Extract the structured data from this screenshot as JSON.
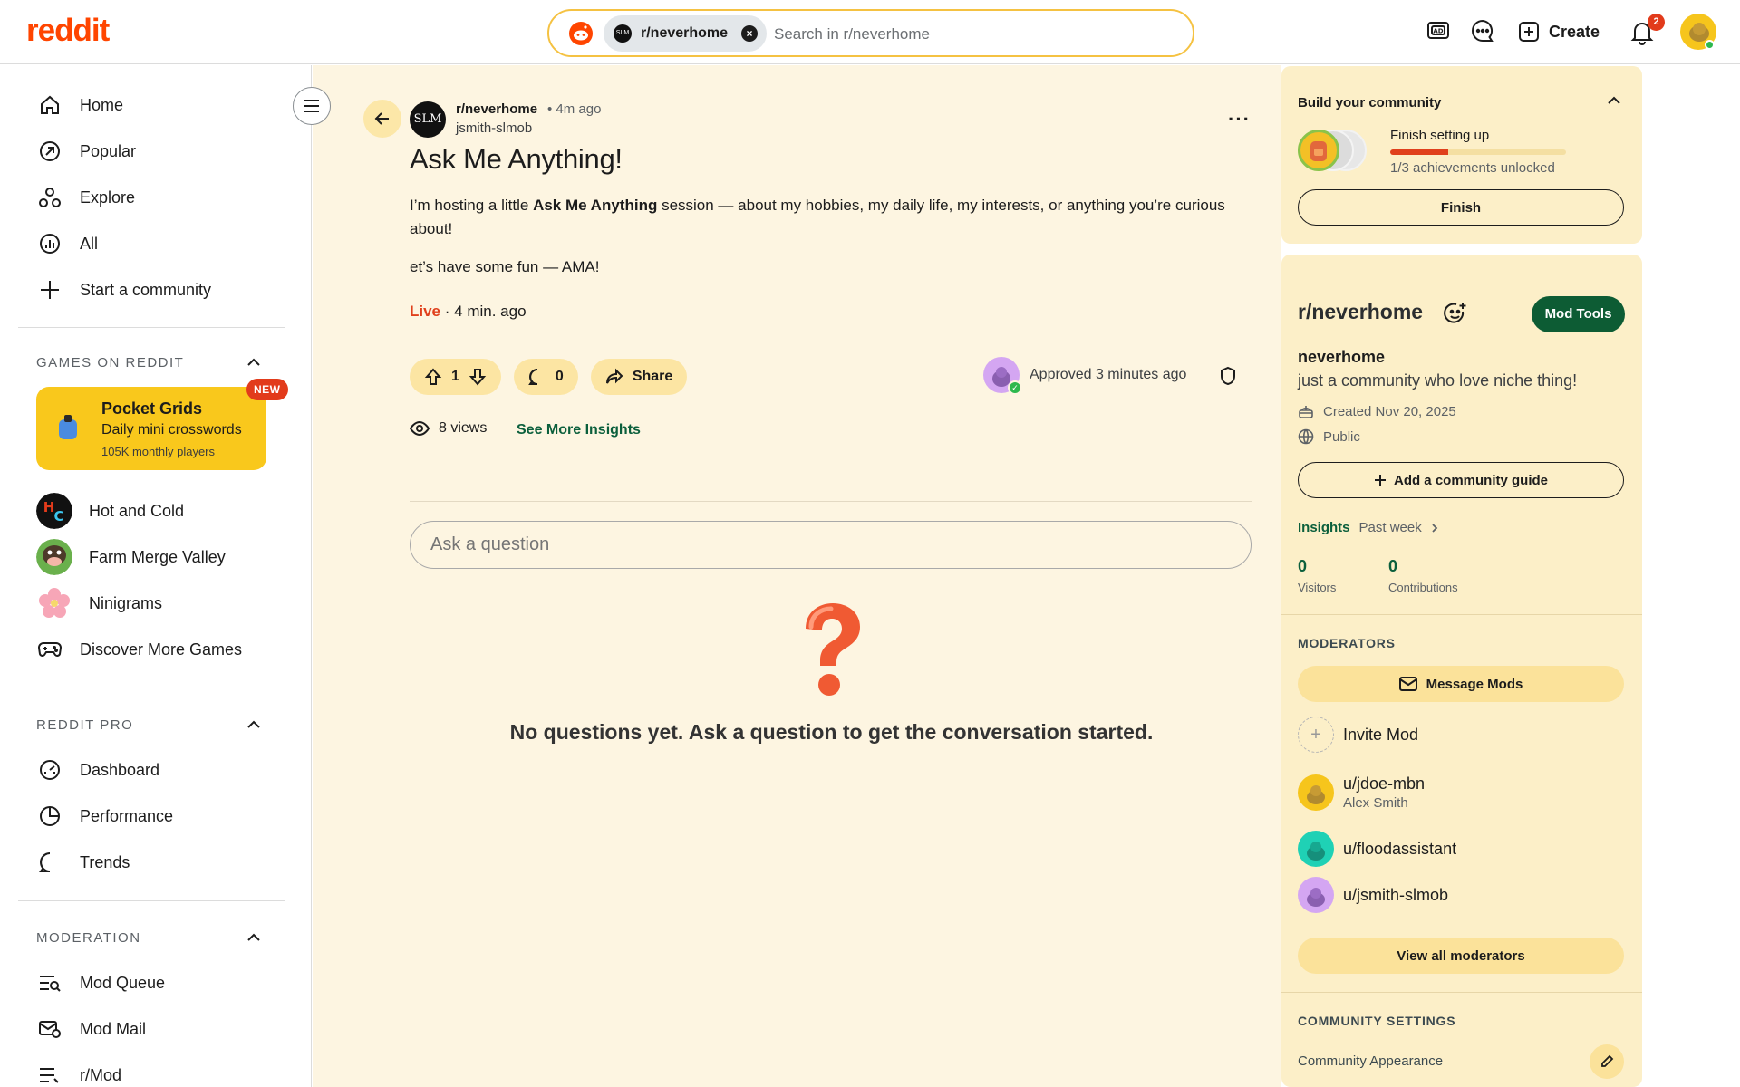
{
  "header": {
    "logo": "reddit",
    "search_chip": "r/neverhome",
    "search_placeholder": "Search in r/neverhome",
    "create_label": "Create",
    "notification_count": "2"
  },
  "sidebar": {
    "main_nav": [
      {
        "label": "Home",
        "icon": "home-icon"
      },
      {
        "label": "Popular",
        "icon": "popular-icon"
      },
      {
        "label": "Explore",
        "icon": "explore-icon"
      },
      {
        "label": "All",
        "icon": "all-icon"
      },
      {
        "label": "Start a community",
        "icon": "plus-icon"
      }
    ],
    "games_title": "GAMES ON REDDIT",
    "featured_game": {
      "title": "Pocket Grids",
      "subtitle": "Daily mini crosswords",
      "meta": "105K monthly players",
      "badge": "NEW"
    },
    "games": [
      {
        "label": "Hot and Cold"
      },
      {
        "label": "Farm Merge Valley"
      },
      {
        "label": "Ninigrams"
      },
      {
        "label": "Discover More Games"
      }
    ],
    "pro_title": "REDDIT PRO",
    "pro_nav": [
      {
        "label": "Dashboard"
      },
      {
        "label": "Performance"
      },
      {
        "label": "Trends"
      }
    ],
    "mod_title": "MODERATION",
    "mod_nav": [
      {
        "label": "Mod Queue"
      },
      {
        "label": "Mod Mail"
      },
      {
        "label": "r/Mod"
      }
    ]
  },
  "post": {
    "avatar_text": "SLM",
    "subreddit": "r/neverhome",
    "time": "• 4m ago",
    "author": "jsmith-slmob",
    "title": "Ask Me Anything!",
    "body_pre": "I’m hosting a little ",
    "body_bold": "Ask Me Anything",
    "body_post": " session — about my hobbies, my daily life, my interests, or anything you’re curious about!",
    "body2": "et’s have some fun — AMA!",
    "live_label": "Live",
    "live_time": " · 4 min. ago",
    "votes": "1",
    "comments": "0",
    "share_label": "Share",
    "approved_text": "Approved 3 minutes ago",
    "views": "8 views",
    "insights_link": "See More Insights",
    "ask_placeholder": "Ask a question",
    "empty_message": "No questions yet. Ask a question to get the conversation started."
  },
  "build_card": {
    "title": "Build your community",
    "progress_title": "Finish setting up",
    "progress_sub": "1/3 achievements unlocked",
    "progress_fraction": 0.33,
    "finish_label": "Finish"
  },
  "community": {
    "name": "r/neverhome",
    "mod_tools_label": "Mod Tools",
    "handle": "neverhome",
    "description": "just a community who love niche thing!",
    "created": "Created Nov 20, 2025",
    "visibility": "Public",
    "guide_label": "Add a community guide",
    "insights_title": "Insights",
    "insights_period": "Past week",
    "visitors_value": "0",
    "visitors_label": "Visitors",
    "contrib_value": "0",
    "contrib_label": "Contributions",
    "moderators_title": "MODERATORS",
    "message_mods_label": "Message Mods",
    "invite_label": "Invite Mod",
    "moderators": [
      {
        "name": "u/jdoe-mbn",
        "real_name": "Alex Smith",
        "color": "#f6c51c"
      },
      {
        "name": "u/floodassistant",
        "real_name": "",
        "color": "#1fd1b5"
      },
      {
        "name": "u/jsmith-slmob",
        "real_name": "",
        "color": "#d4a6f2"
      }
    ],
    "view_all_label": "View all moderators",
    "settings_title": "COMMUNITY SETTINGS",
    "appearance_label": "Community Appearance"
  },
  "colors": {
    "brand": "#ff4500",
    "main_bg": "#fdf5e1",
    "panel_bg": "#fcefc8",
    "accent_green": "#0d5c34"
  }
}
